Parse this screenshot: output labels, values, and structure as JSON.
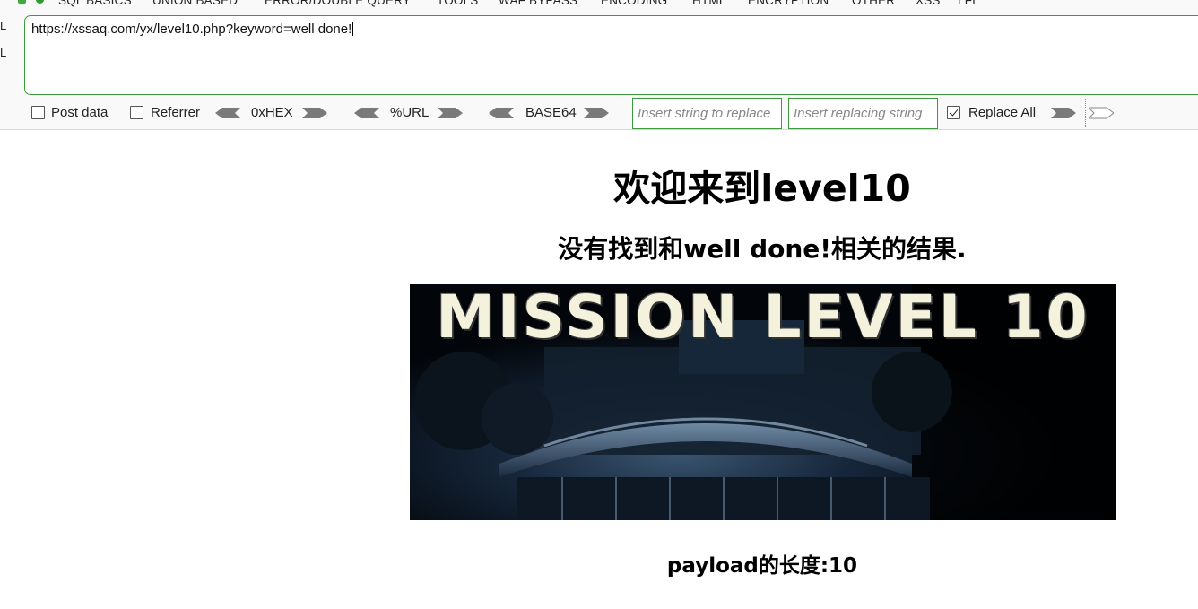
{
  "hackbar": {
    "menu": [
      {
        "label": "SQL BASICS"
      },
      {
        "label": "UNION BASED"
      },
      {
        "label": "ERROR/DOUBLE QUERY"
      },
      {
        "label": "TOOLS"
      },
      {
        "label": "WAF BYPASS"
      },
      {
        "label": "ENCODING"
      },
      {
        "label": "HTML"
      },
      {
        "label": "ENCRYPTION"
      },
      {
        "label": "OTHER"
      },
      {
        "label": "XSS"
      },
      {
        "label": "LFI"
      }
    ],
    "side_labels": [
      "L",
      "L"
    ],
    "url_value": "https://xssaq.com/yx/level10.php?keyword=well done!",
    "post_data_label": "Post data",
    "post_data_checked": false,
    "referrer_label": "Referrer",
    "referrer_checked": false,
    "hex_label": "0xHEX",
    "url_enc_label": "%URL",
    "base64_label": "BASE64",
    "replace_from_placeholder": "Insert string to replace",
    "replace_to_placeholder": "Insert replacing string",
    "replace_all_label": "Replace All",
    "replace_all_checked": true,
    "accent_color": "#3c9a3c"
  },
  "page": {
    "title": "欢迎来到level10",
    "result": "没有找到和well done!相关的结果.",
    "banner_text": "MISSION LEVEL 10",
    "payload_length": "payload的长度:10"
  }
}
